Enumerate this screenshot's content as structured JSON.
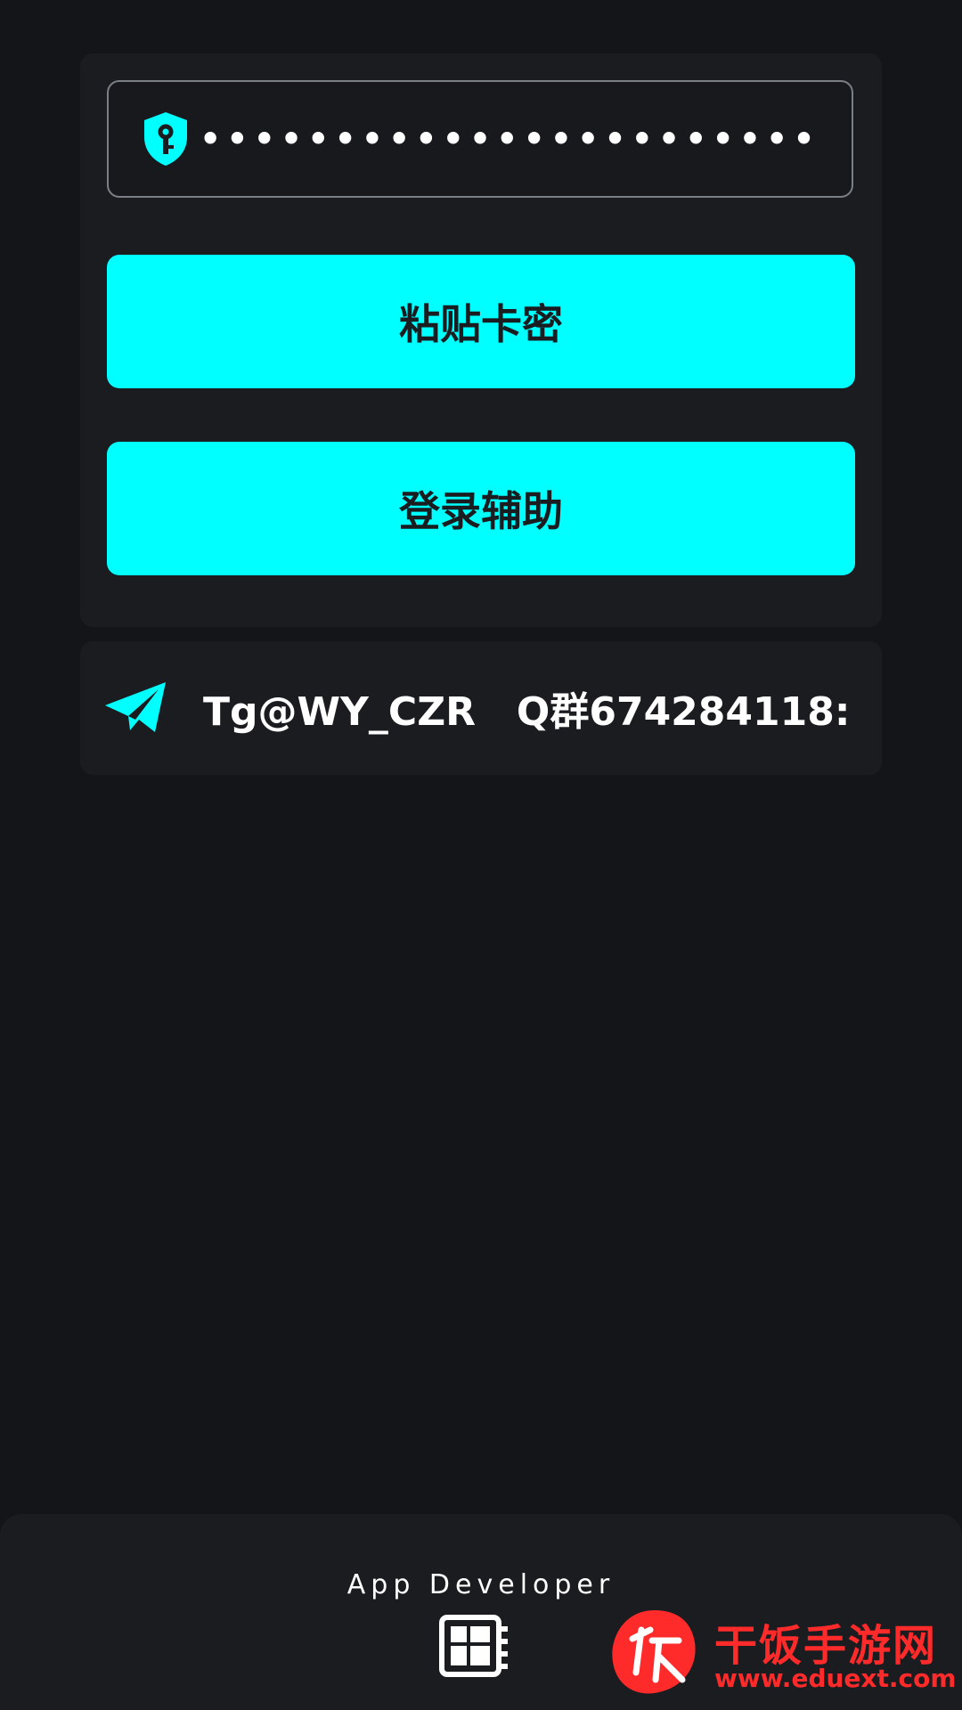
{
  "login": {
    "key_field_value": "•••••••••••••••••••••••",
    "paste_button_label": "粘贴卡密",
    "login_button_label": "登录辅助"
  },
  "contact": {
    "text": "Tg@WY_CZR   Q群674284118:"
  },
  "footer": {
    "developer_label": "App Developer"
  },
  "watermark": {
    "title": "干饭手游网",
    "url": "www.eduext.com"
  },
  "colors": {
    "accent": "#00ffff",
    "background": "#131519",
    "card": "#1a1c20",
    "watermark": "#ff2b2b"
  },
  "icons": {
    "key_field": "shield-key-icon",
    "contact": "telegram-icon",
    "footer": "chip-icon"
  }
}
